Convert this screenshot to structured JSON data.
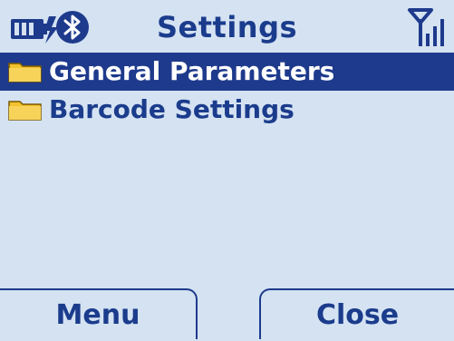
{
  "status_bar": {
    "title": "Settings",
    "icons": [
      "battery-charging-icon",
      "bluetooth-icon",
      "signal-strength-icon"
    ]
  },
  "menu": {
    "items": [
      {
        "label": "General Parameters",
        "icon": "folder-icon",
        "selected": true
      },
      {
        "label": "Barcode Settings",
        "icon": "folder-icon",
        "selected": false
      }
    ]
  },
  "softkeys": {
    "left": "Menu",
    "right": "Close"
  },
  "colors": {
    "background": "#d4e2f2",
    "accent": "#1e3a8c",
    "text": "#1b3c8c",
    "folder": "#f2c12e"
  }
}
